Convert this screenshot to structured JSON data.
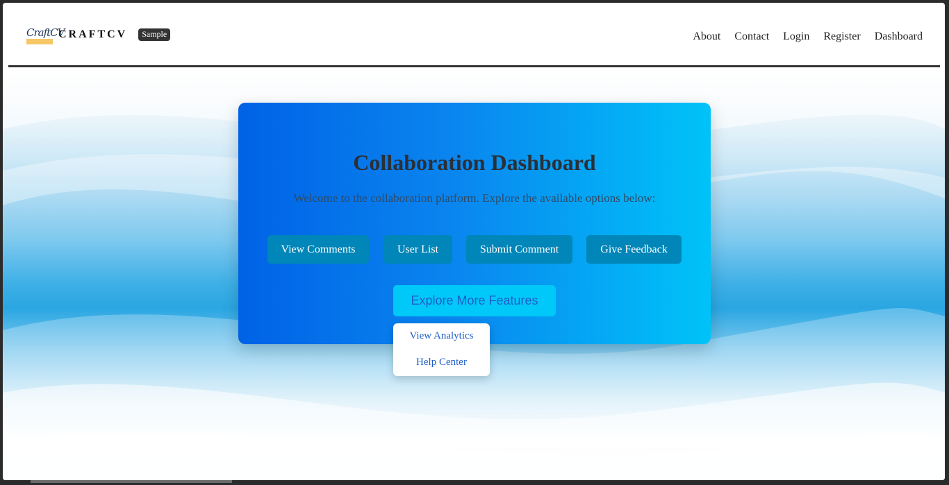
{
  "navbar": {
    "logo_text": "CraftCV",
    "brand_name": "CRAFTCV",
    "badge": "Sample",
    "links": [
      "About",
      "Contact",
      "Login",
      "Register",
      "Dashboard"
    ]
  },
  "card": {
    "title": "Collaboration Dashboard",
    "subtitle": "Welcome to the collaboration platform. Explore the available options below:",
    "buttons": [
      "View Comments",
      "User List",
      "Submit Comment",
      "Give Feedback"
    ],
    "explore_label": "Explore More Features"
  },
  "dropdown": {
    "items": [
      "View Analytics",
      "Help Center"
    ]
  },
  "colors": {
    "card_gradient_start": "#0062e6",
    "card_gradient_end": "#00c3f8",
    "button_bg": "#0086b8",
    "explore_bg": "#00c8f8",
    "link_blue": "#1f5ec9"
  }
}
